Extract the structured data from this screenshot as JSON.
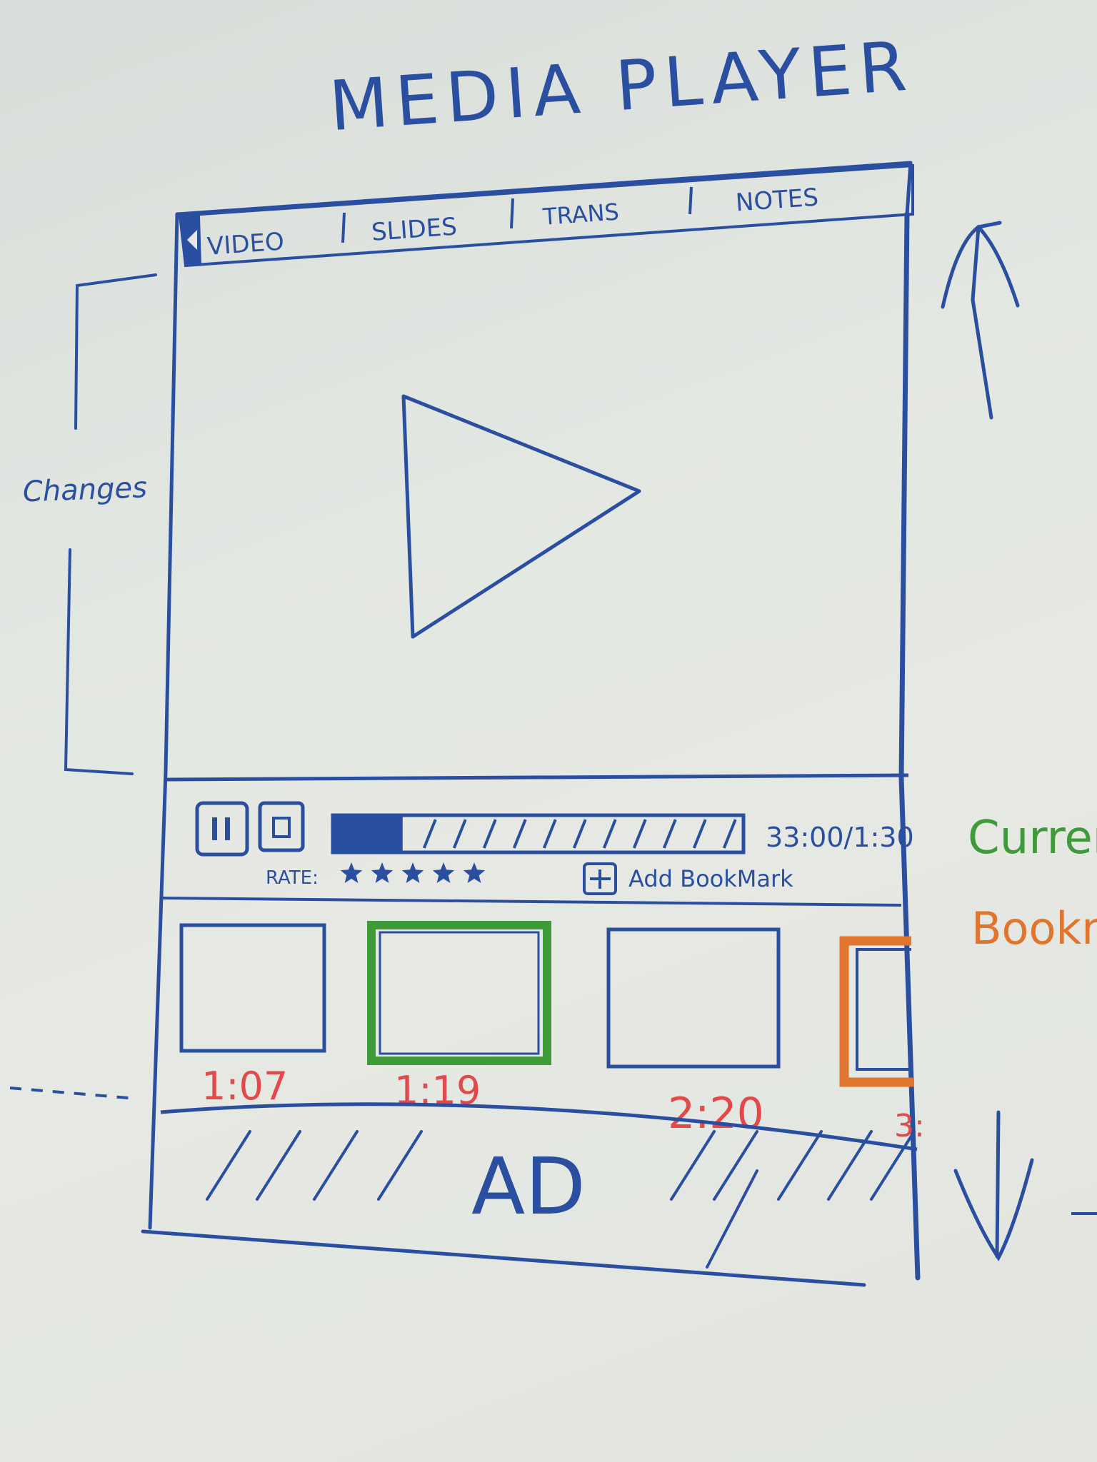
{
  "title": "MEDIA PLAYER",
  "tabs": [
    {
      "label": "VIDEO"
    },
    {
      "label": "SLIDES"
    },
    {
      "label": "TRANS"
    },
    {
      "label": "NOTES"
    }
  ],
  "annotations": {
    "left_bracket": "Changes",
    "right_green": "Curren",
    "right_orange": "Bookn"
  },
  "controls": {
    "pause_icon": "pause-icon",
    "stop_icon": "stop-icon",
    "progress": 0.17,
    "time": "33:00/1:30",
    "rate_label": "RATE:",
    "stars": 5,
    "add_bookmark": "Add BookMark"
  },
  "bookmarks": [
    {
      "time": "1:07",
      "state": "normal"
    },
    {
      "time": "1:19",
      "state": "current"
    },
    {
      "time": "2:20",
      "state": "normal"
    },
    {
      "time": "3:",
      "state": "bookmarked"
    }
  ],
  "ad": {
    "label": "AD"
  },
  "colors": {
    "ink_blue": "#2b4fa0",
    "current_green": "#3f9a3a",
    "bookmark_orange": "#e0762e",
    "time_red": "#e2494a"
  }
}
